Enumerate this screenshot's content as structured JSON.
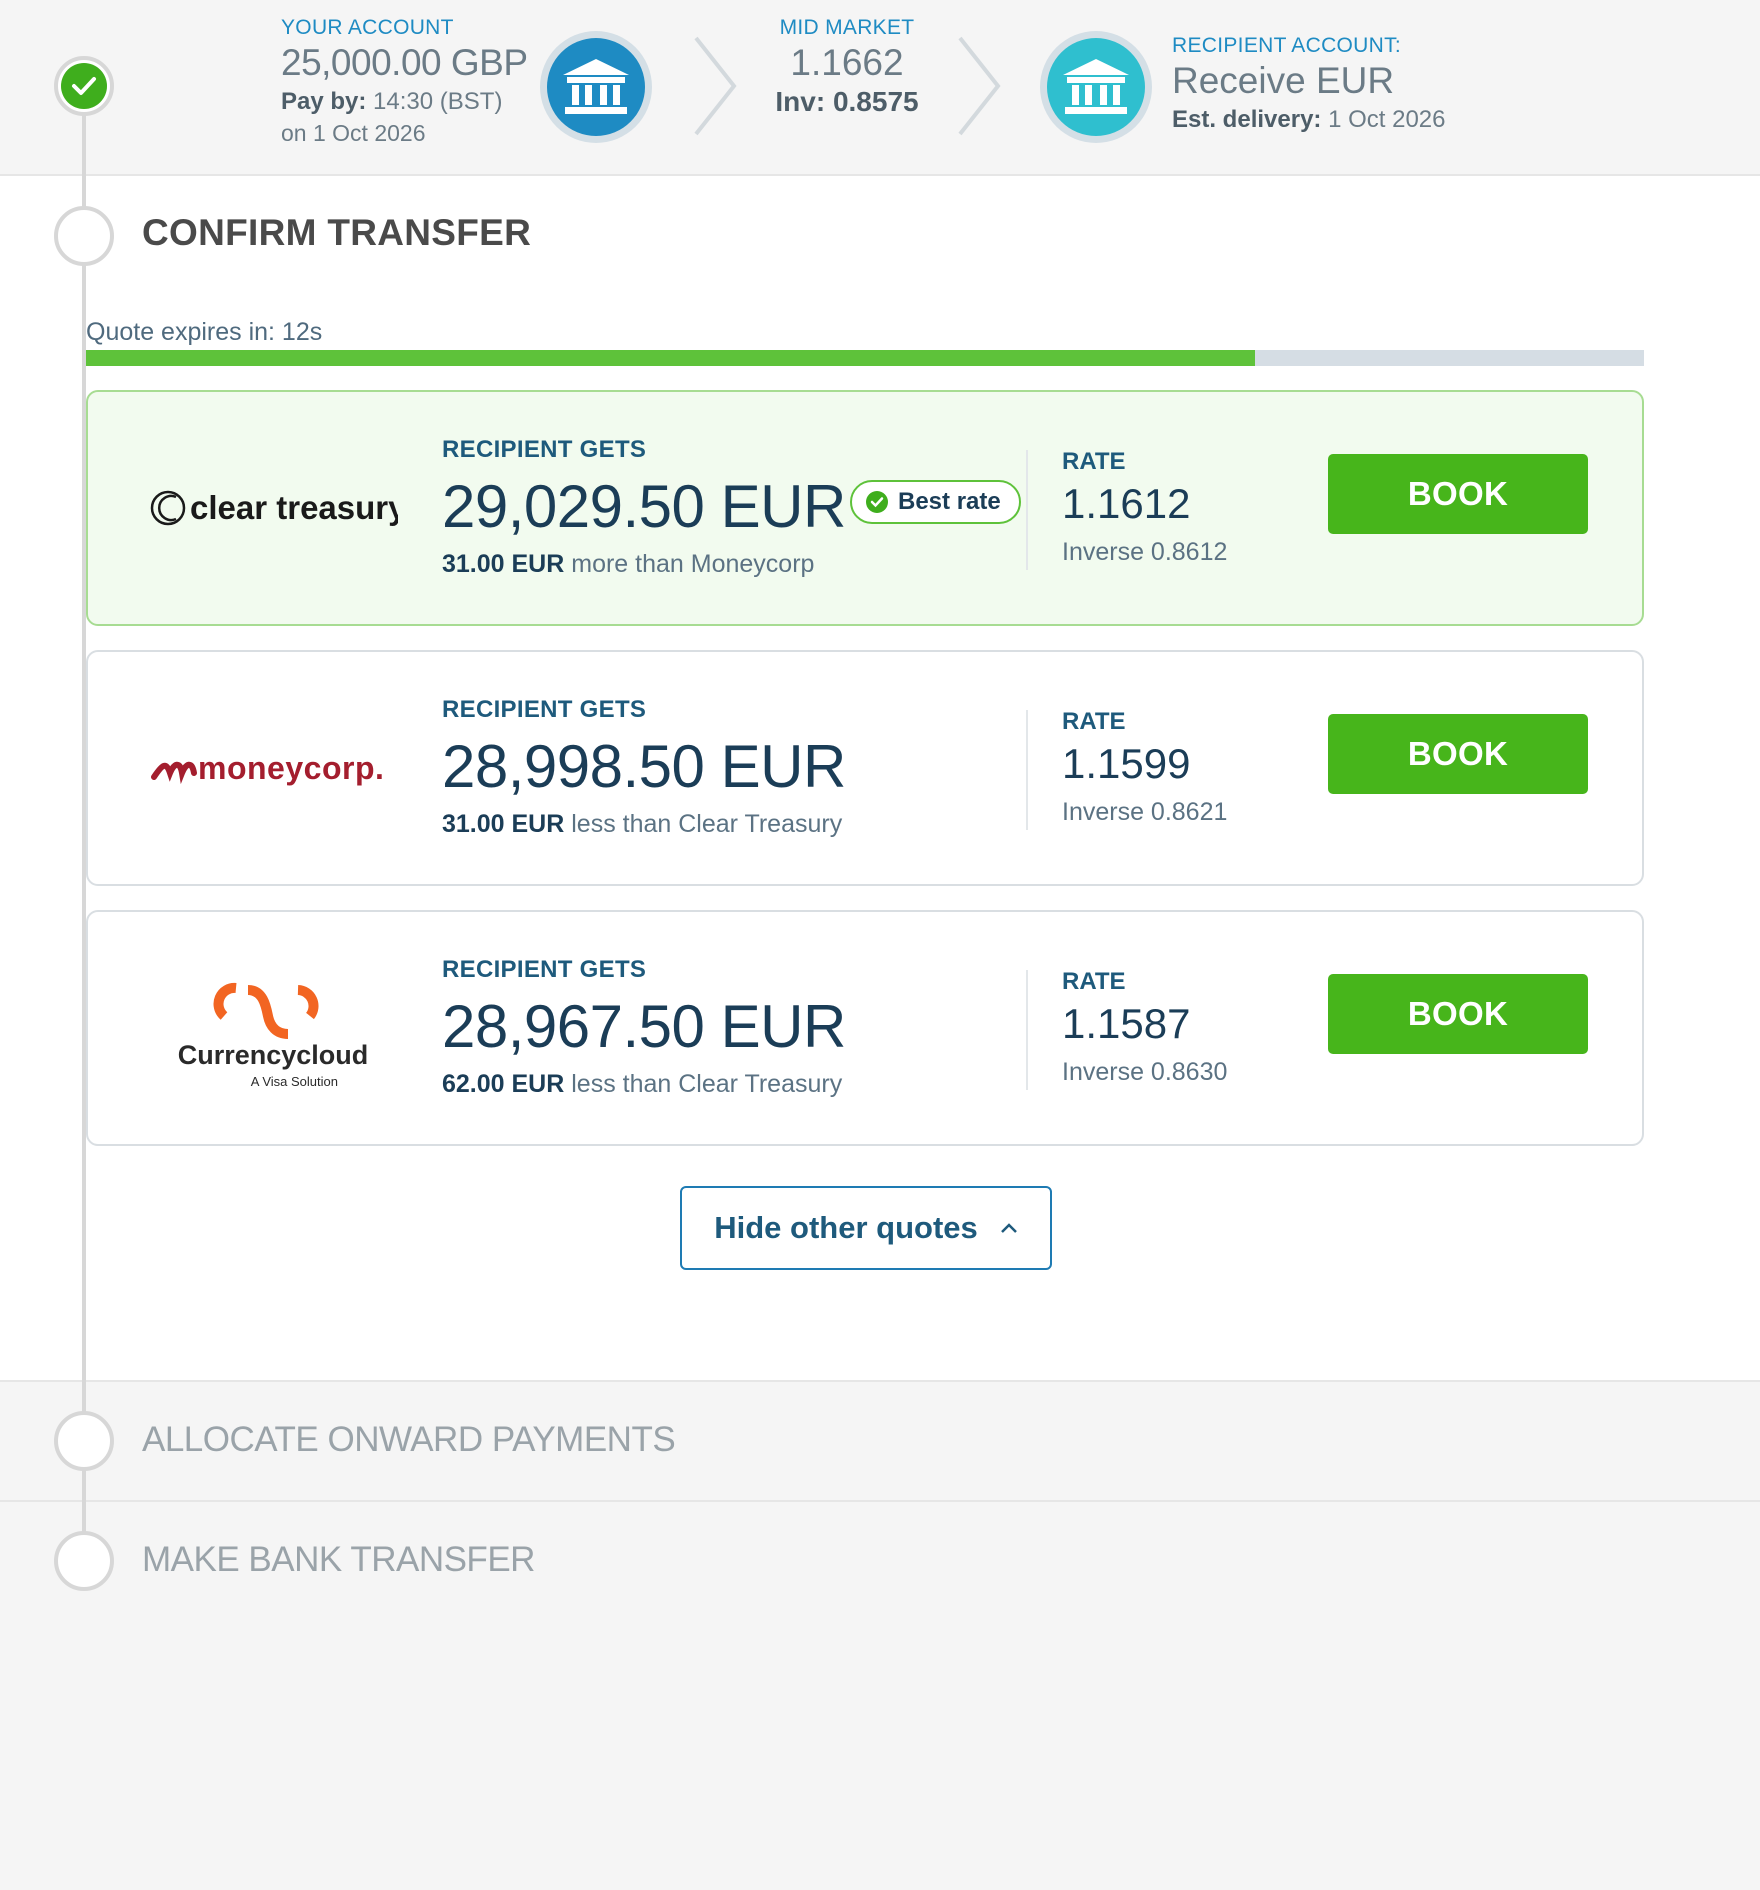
{
  "header": {
    "your_account": {
      "label": "YOUR ACCOUNT",
      "amount": "25,000.00 GBP",
      "pay_by_label": "Pay by:",
      "pay_by_time": "14:30 (BST)",
      "pay_by_date": "on 1 Oct 2026"
    },
    "mid_market": {
      "label": "MID MARKET",
      "rate": "1.1662",
      "inv_label": "Inv:",
      "inv_value": "0.8575"
    },
    "recipient": {
      "label": "RECIPIENT ACCOUNT:",
      "receive": "Receive EUR",
      "delivery_label": "Est. delivery:",
      "delivery_date": "1 Oct 2026"
    }
  },
  "confirm": {
    "title": "CONFIRM TRANSFER",
    "expires_label": "Quote expires in: 12s",
    "progress_fraction": 0.75
  },
  "quotes": [
    {
      "provider": "clear treasury",
      "recipient_label": "RECIPIENT GETS",
      "amount": "29,029.50 EUR",
      "badge": "Best rate",
      "diff_amount": "31.00 EUR",
      "diff_text": "more than Moneycorp",
      "rate_label": "RATE",
      "rate": "1.1612",
      "inverse": "Inverse 0.8612",
      "book_label": "BOOK"
    },
    {
      "provider": "moneycorp.",
      "recipient_label": "RECIPIENT GETS",
      "amount": "28,998.50 EUR",
      "diff_amount": "31.00 EUR",
      "diff_text": "less than Clear Treasury",
      "rate_label": "RATE",
      "rate": "1.1599",
      "inverse": "Inverse 0.8621",
      "book_label": "BOOK"
    },
    {
      "provider": "Currencycloud",
      "provider_sub": "A Visa Solution",
      "recipient_label": "RECIPIENT GETS",
      "amount": "28,967.50 EUR",
      "diff_amount": "62.00 EUR",
      "diff_text": "less than Clear Treasury",
      "rate_label": "RATE",
      "rate": "1.1587",
      "inverse": "Inverse 0.8630",
      "book_label": "BOOK"
    }
  ],
  "hide_quotes_label": "Hide other quotes",
  "steps": {
    "allocate": "ALLOCATE ONWARD PAYMENTS",
    "bank_transfer": "MAKE BANK TRANSFER"
  },
  "colors": {
    "accent_blue": "#1e8bc3",
    "book_green": "#47b51b",
    "progress_green": "#5ec23a",
    "moneycorp_red": "#a41e2e",
    "currencycloud_orange": "#f26522"
  }
}
